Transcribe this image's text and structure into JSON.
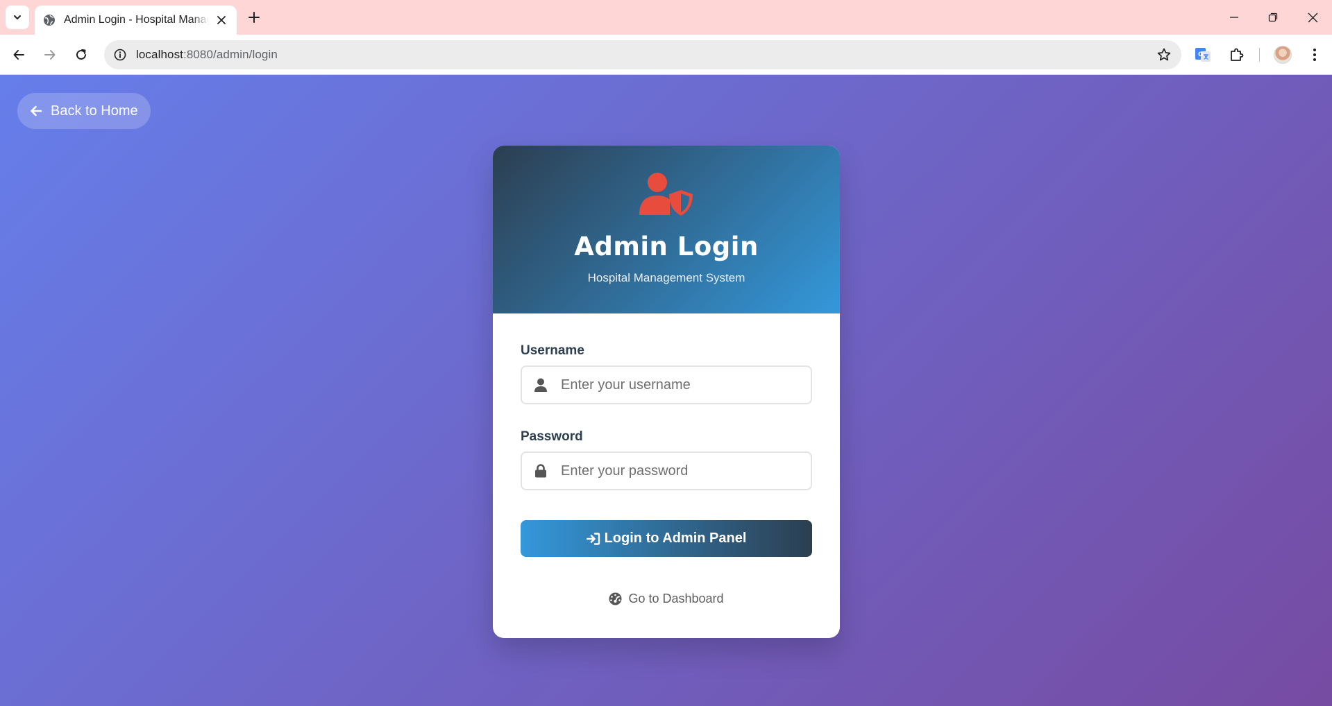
{
  "browser": {
    "tab_title": "Admin Login - Hospital Management System",
    "url_host": "localhost",
    "url_path": ":8080/admin/login"
  },
  "page": {
    "back_home_label": "Back to Home",
    "card": {
      "title": "Admin Login",
      "subtitle": "Hospital Management System",
      "username_label": "Username",
      "username_placeholder": "Enter your username",
      "password_label": "Password",
      "password_placeholder": "Enter your password",
      "login_button_label": "Login to Admin Panel",
      "dashboard_link_label": "Go to Dashboard"
    }
  },
  "colors": {
    "page_gradient_start": "#667eea",
    "page_gradient_end": "#764ba2",
    "header_gradient_start": "#2c3e50",
    "header_gradient_end": "#3498db",
    "admin_icon": "#e74c3c",
    "label_text": "#2c3e50"
  }
}
